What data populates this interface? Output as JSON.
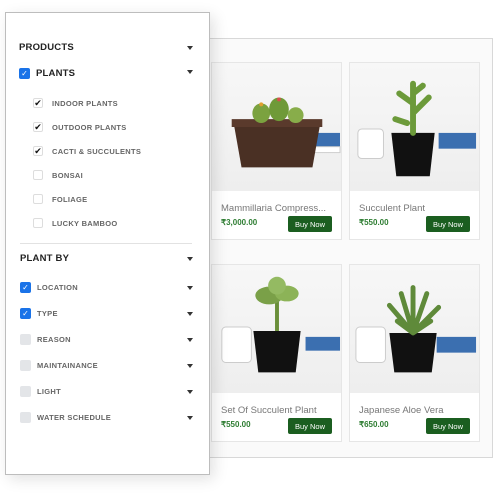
{
  "sidebar": {
    "products": {
      "label": "PRODUCTS"
    },
    "plants": {
      "label": "PLANTS",
      "checked": true,
      "items": [
        {
          "label": "INDOOR PLANTS",
          "checked": true
        },
        {
          "label": "OUTDOOR PLANTS",
          "checked": true
        },
        {
          "label": "CACTI & SUCCULENTS",
          "checked": true
        },
        {
          "label": "BONSAI",
          "checked": false
        },
        {
          "label": "FOLIAGE",
          "checked": false
        },
        {
          "label": "LUCKY BAMBOO",
          "checked": false
        }
      ]
    },
    "plant_by": {
      "label": "PLANT BY",
      "items": [
        {
          "label": "LOCATION",
          "checked": true
        },
        {
          "label": "TYPE",
          "checked": true
        },
        {
          "label": "REASON",
          "checked": false
        },
        {
          "label": "MAINTAINANCE",
          "checked": false
        },
        {
          "label": "LIGHT",
          "checked": false
        },
        {
          "label": "WATER SCHEDULE",
          "checked": false
        }
      ]
    }
  },
  "products": [
    {
      "name": "Mammillaria Compress...",
      "price": "₹3,000.00",
      "button": "Buy Now"
    },
    {
      "name": "Succulent Plant",
      "price": "₹550.00",
      "button": "Buy Now"
    },
    {
      "name": "Set Of Succulent Plant",
      "price": "₹550.00",
      "button": "Buy Now"
    },
    {
      "name": "Japanese Aloe Vera",
      "price": "₹650.00",
      "button": "Buy Now"
    }
  ],
  "colors": {
    "accent": "#1a73e8",
    "buy_button": "#1b5e20",
    "price": "#2e7d32"
  }
}
